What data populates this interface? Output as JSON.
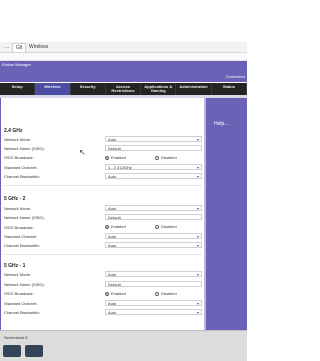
{
  "browser": {
    "tabs": [
      "...",
      "Glt",
      "Wireless"
    ]
  },
  "router": {
    "banner_left": "Router Manager",
    "banner_right": "Connected",
    "nav": [
      "Setup",
      "Wireless",
      "Security",
      "Access Restrictions",
      "Applications & Gaming",
      "Administration",
      "Status"
    ],
    "active_nav": "Wireless",
    "help_text": "Help..."
  },
  "sections": [
    {
      "title": "2.4 GHz",
      "rows": [
        {
          "label": "Network Mode:",
          "value": "Auto",
          "kind": "select"
        },
        {
          "label": "Network Name (SSID):",
          "value": "Default",
          "kind": "input"
        },
        {
          "label": "SSID Broadcast:",
          "options": [
            "Enabled",
            "Disabled"
          ],
          "selected": "Enabled",
          "kind": "radio"
        },
        {
          "label": "Standard Channel:",
          "value": "1 - 2.412GHz",
          "kind": "select"
        },
        {
          "label": "Channel Bandwidth:",
          "value": "Auto",
          "kind": "select"
        }
      ]
    },
    {
      "title": "5 GHz - 2",
      "rows": [
        {
          "label": "Network Mode:",
          "value": "Auto",
          "kind": "select"
        },
        {
          "label": "Network Name (SSID):",
          "value": "Default",
          "kind": "input"
        },
        {
          "label": "SSID Broadcast:",
          "options": [
            "Enabled",
            "Disabled"
          ],
          "selected": "Enabled",
          "kind": "radio"
        },
        {
          "label": "Standard Channel:",
          "value": "Auto",
          "kind": "select"
        },
        {
          "label": "Channel Bandwidth:",
          "value": "Auto",
          "kind": "select"
        }
      ]
    },
    {
      "title": "5 GHz - 1",
      "rows": [
        {
          "label": "Network Mode:",
          "value": "Auto",
          "kind": "select"
        },
        {
          "label": "Network Name (SSID):",
          "value": "Default",
          "kind": "input"
        },
        {
          "label": "SSID Broadcast:",
          "options": [
            "Enabled",
            "Disabled"
          ],
          "selected": "Enabled",
          "kind": "radio"
        },
        {
          "label": "Standard Channel:",
          "value": "Auto",
          "kind": "select"
        },
        {
          "label": "Channel Bandwidth:",
          "value": "Auto",
          "kind": "select"
        }
      ]
    }
  ],
  "taskbar": {
    "label": "Screenshot 5"
  },
  "colors": {
    "brand_purple": "#6a62b7",
    "nav_dark": "#242424",
    "nav_active": "#4b4da3"
  }
}
